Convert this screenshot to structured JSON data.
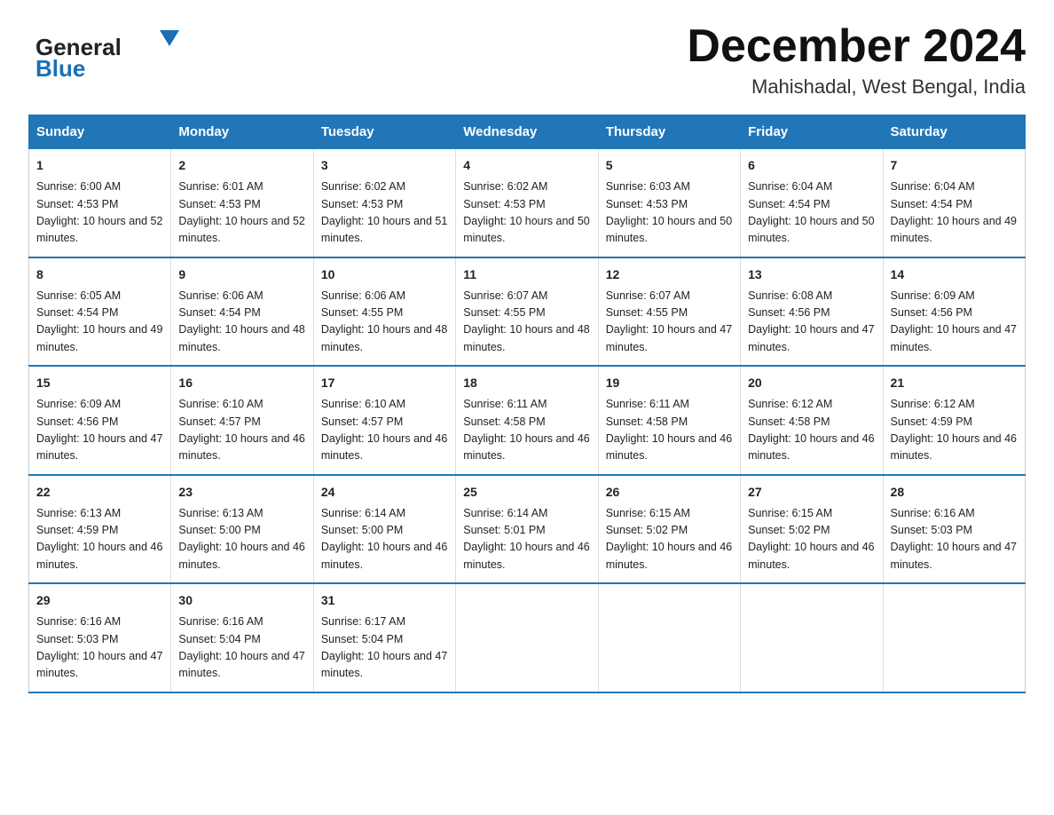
{
  "header": {
    "title": "December 2024",
    "subtitle": "Mahishadal, West Bengal, India",
    "logo_general": "General",
    "logo_blue": "Blue"
  },
  "days_of_week": [
    "Sunday",
    "Monday",
    "Tuesday",
    "Wednesday",
    "Thursday",
    "Friday",
    "Saturday"
  ],
  "weeks": [
    [
      {
        "day": "1",
        "sunrise": "6:00 AM",
        "sunset": "4:53 PM",
        "daylight": "10 hours and 52 minutes."
      },
      {
        "day": "2",
        "sunrise": "6:01 AM",
        "sunset": "4:53 PM",
        "daylight": "10 hours and 52 minutes."
      },
      {
        "day": "3",
        "sunrise": "6:02 AM",
        "sunset": "4:53 PM",
        "daylight": "10 hours and 51 minutes."
      },
      {
        "day": "4",
        "sunrise": "6:02 AM",
        "sunset": "4:53 PM",
        "daylight": "10 hours and 50 minutes."
      },
      {
        "day": "5",
        "sunrise": "6:03 AM",
        "sunset": "4:53 PM",
        "daylight": "10 hours and 50 minutes."
      },
      {
        "day": "6",
        "sunrise": "6:04 AM",
        "sunset": "4:54 PM",
        "daylight": "10 hours and 50 minutes."
      },
      {
        "day": "7",
        "sunrise": "6:04 AM",
        "sunset": "4:54 PM",
        "daylight": "10 hours and 49 minutes."
      }
    ],
    [
      {
        "day": "8",
        "sunrise": "6:05 AM",
        "sunset": "4:54 PM",
        "daylight": "10 hours and 49 minutes."
      },
      {
        "day": "9",
        "sunrise": "6:06 AM",
        "sunset": "4:54 PM",
        "daylight": "10 hours and 48 minutes."
      },
      {
        "day": "10",
        "sunrise": "6:06 AM",
        "sunset": "4:55 PM",
        "daylight": "10 hours and 48 minutes."
      },
      {
        "day": "11",
        "sunrise": "6:07 AM",
        "sunset": "4:55 PM",
        "daylight": "10 hours and 48 minutes."
      },
      {
        "day": "12",
        "sunrise": "6:07 AM",
        "sunset": "4:55 PM",
        "daylight": "10 hours and 47 minutes."
      },
      {
        "day": "13",
        "sunrise": "6:08 AM",
        "sunset": "4:56 PM",
        "daylight": "10 hours and 47 minutes."
      },
      {
        "day": "14",
        "sunrise": "6:09 AM",
        "sunset": "4:56 PM",
        "daylight": "10 hours and 47 minutes."
      }
    ],
    [
      {
        "day": "15",
        "sunrise": "6:09 AM",
        "sunset": "4:56 PM",
        "daylight": "10 hours and 47 minutes."
      },
      {
        "day": "16",
        "sunrise": "6:10 AM",
        "sunset": "4:57 PM",
        "daylight": "10 hours and 46 minutes."
      },
      {
        "day": "17",
        "sunrise": "6:10 AM",
        "sunset": "4:57 PM",
        "daylight": "10 hours and 46 minutes."
      },
      {
        "day": "18",
        "sunrise": "6:11 AM",
        "sunset": "4:58 PM",
        "daylight": "10 hours and 46 minutes."
      },
      {
        "day": "19",
        "sunrise": "6:11 AM",
        "sunset": "4:58 PM",
        "daylight": "10 hours and 46 minutes."
      },
      {
        "day": "20",
        "sunrise": "6:12 AM",
        "sunset": "4:58 PM",
        "daylight": "10 hours and 46 minutes."
      },
      {
        "day": "21",
        "sunrise": "6:12 AM",
        "sunset": "4:59 PM",
        "daylight": "10 hours and 46 minutes."
      }
    ],
    [
      {
        "day": "22",
        "sunrise": "6:13 AM",
        "sunset": "4:59 PM",
        "daylight": "10 hours and 46 minutes."
      },
      {
        "day": "23",
        "sunrise": "6:13 AM",
        "sunset": "5:00 PM",
        "daylight": "10 hours and 46 minutes."
      },
      {
        "day": "24",
        "sunrise": "6:14 AM",
        "sunset": "5:00 PM",
        "daylight": "10 hours and 46 minutes."
      },
      {
        "day": "25",
        "sunrise": "6:14 AM",
        "sunset": "5:01 PM",
        "daylight": "10 hours and 46 minutes."
      },
      {
        "day": "26",
        "sunrise": "6:15 AM",
        "sunset": "5:02 PM",
        "daylight": "10 hours and 46 minutes."
      },
      {
        "day": "27",
        "sunrise": "6:15 AM",
        "sunset": "5:02 PM",
        "daylight": "10 hours and 46 minutes."
      },
      {
        "day": "28",
        "sunrise": "6:16 AM",
        "sunset": "5:03 PM",
        "daylight": "10 hours and 47 minutes."
      }
    ],
    [
      {
        "day": "29",
        "sunrise": "6:16 AM",
        "sunset": "5:03 PM",
        "daylight": "10 hours and 47 minutes."
      },
      {
        "day": "30",
        "sunrise": "6:16 AM",
        "sunset": "5:04 PM",
        "daylight": "10 hours and 47 minutes."
      },
      {
        "day": "31",
        "sunrise": "6:17 AM",
        "sunset": "5:04 PM",
        "daylight": "10 hours and 47 minutes."
      },
      null,
      null,
      null,
      null
    ]
  ],
  "labels": {
    "sunrise_prefix": "Sunrise: ",
    "sunset_prefix": "Sunset: ",
    "daylight_prefix": "Daylight: "
  }
}
